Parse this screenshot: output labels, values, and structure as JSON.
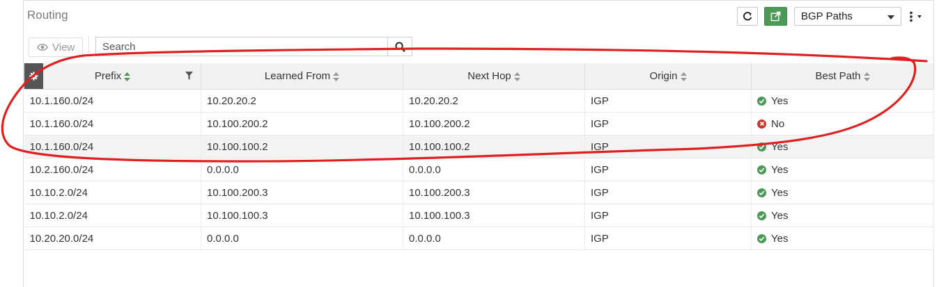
{
  "header": {
    "title": "Routing",
    "dropdown_value": "BGP Paths"
  },
  "toolbar": {
    "view_label": "View",
    "search_placeholder": "Search"
  },
  "columns": [
    "Prefix",
    "Learned From",
    "Next Hop",
    "Origin",
    "Best Path"
  ],
  "rows": [
    {
      "prefix": "10.1.160.0/24",
      "learned_from": "10.20.20.2",
      "next_hop": "10.20.20.2",
      "origin": "IGP",
      "best_path": "Yes",
      "best": true
    },
    {
      "prefix": "10.1.160.0/24",
      "learned_from": "10.100.200.2",
      "next_hop": "10.100.200.2",
      "origin": "IGP",
      "best_path": "No",
      "best": false
    },
    {
      "prefix": "10.1.160.0/24",
      "learned_from": "10.100.100.2",
      "next_hop": "10.100.100.2",
      "origin": "IGP",
      "best_path": "Yes",
      "best": true
    },
    {
      "prefix": "10.2.160.0/24",
      "learned_from": "0.0.0.0",
      "next_hop": "0.0.0.0",
      "origin": "IGP",
      "best_path": "Yes",
      "best": true
    },
    {
      "prefix": "10.10.2.0/24",
      "learned_from": "10.100.200.3",
      "next_hop": "10.100.200.3",
      "origin": "IGP",
      "best_path": "Yes",
      "best": true
    },
    {
      "prefix": "10.10.2.0/24",
      "learned_from": "10.100.100.3",
      "next_hop": "10.100.100.3",
      "origin": "IGP",
      "best_path": "Yes",
      "best": true
    },
    {
      "prefix": "10.20.20.0/24",
      "learned_from": "0.0.0.0",
      "next_hop": "0.0.0.0",
      "origin": "IGP",
      "best_path": "Yes",
      "best": true
    }
  ],
  "colors": {
    "accent_green": "#4a9a55",
    "error_red": "#c7392f",
    "annotation_red": "#e02020"
  },
  "icons": [
    "refresh-icon",
    "external-link-icon",
    "chevron-down-icon",
    "kebab-menu-icon",
    "eye-icon",
    "search-icon",
    "gear-icon",
    "filter-icon",
    "sort-icon",
    "check-circle-icon",
    "x-circle-icon"
  ]
}
